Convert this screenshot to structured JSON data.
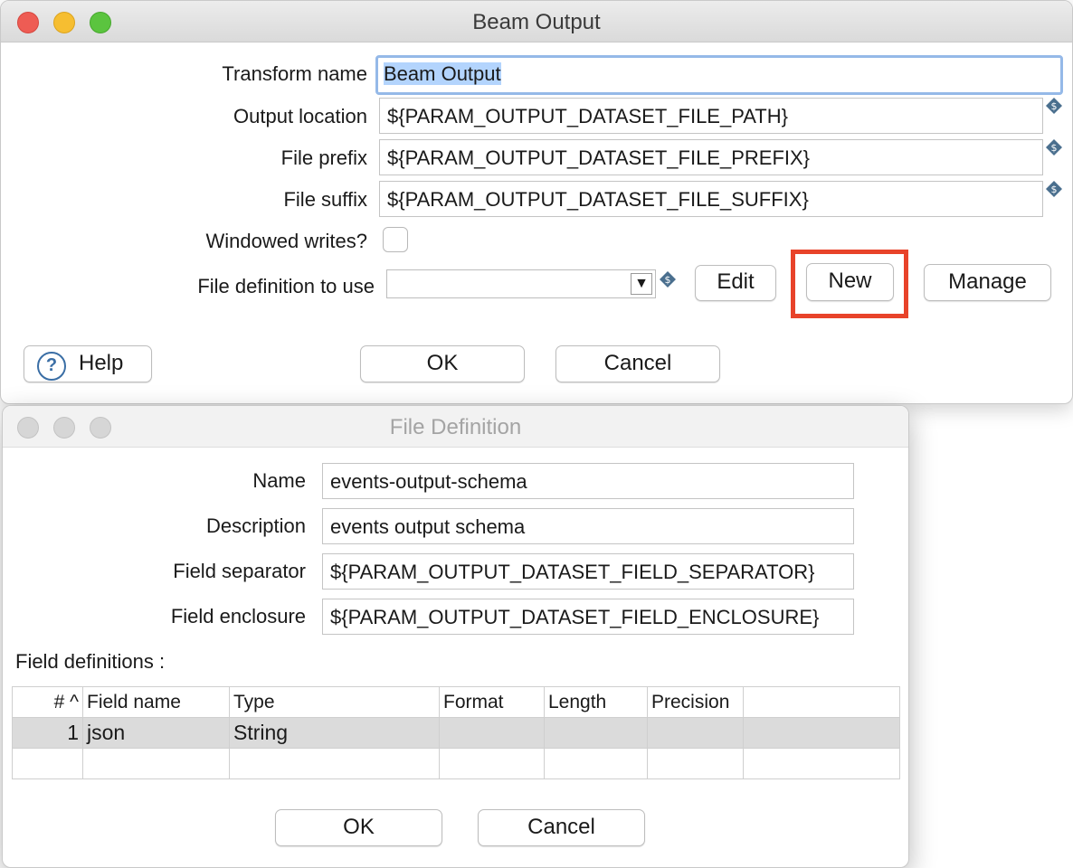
{
  "beam_output": {
    "title": "Beam Output",
    "transform_name": {
      "label": "Transform name",
      "value": "Beam Output"
    },
    "output_location": {
      "label": "Output location",
      "value": "${PARAM_OUTPUT_DATASET_FILE_PATH}"
    },
    "file_prefix": {
      "label": "File prefix",
      "value": "${PARAM_OUTPUT_DATASET_FILE_PREFIX}"
    },
    "file_suffix": {
      "label": "File suffix",
      "value": "${PARAM_OUTPUT_DATASET_FILE_SUFFIX}"
    },
    "windowed_writes": {
      "label": "Windowed writes?",
      "checked": false
    },
    "file_definition": {
      "label": "File definition to use",
      "value": ""
    },
    "buttons": {
      "edit": "Edit",
      "new": "New",
      "manage": "Manage",
      "help": "Help",
      "ok": "OK",
      "cancel": "Cancel"
    },
    "highlight_color": "#e8432a"
  },
  "file_definition": {
    "title": "File Definition",
    "name": {
      "label": "Name",
      "value": "events-output-schema"
    },
    "description": {
      "label": "Description",
      "value": "events output schema"
    },
    "field_separator": {
      "label": "Field separator",
      "value": "${PARAM_OUTPUT_DATASET_FIELD_SEPARATOR}"
    },
    "field_enclosure": {
      "label": "Field enclosure",
      "value": "${PARAM_OUTPUT_DATASET_FIELD_ENCLOSURE}"
    },
    "field_definitions_label": "Field definitions :",
    "columns": [
      "#",
      "Field name",
      "Type",
      "Format",
      "Length",
      "Precision"
    ],
    "rows": [
      {
        "num": "1",
        "field_name": "json",
        "type": "String",
        "format": "",
        "length": "",
        "precision": ""
      }
    ],
    "buttons": {
      "ok": "OK",
      "cancel": "Cancel"
    }
  }
}
